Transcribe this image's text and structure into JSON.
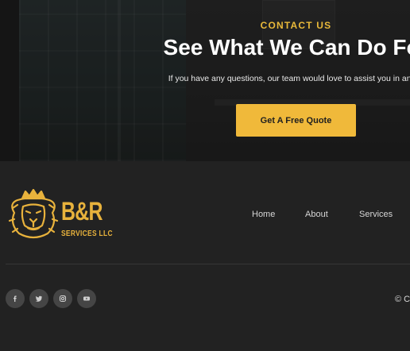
{
  "hero": {
    "eyebrow": "CONTACT US",
    "title": "See What We Can Do For",
    "subtitle": "If you have any questions, our team would love to assist you in any w",
    "cta_label": "Get A Free Quote"
  },
  "brand": {
    "name": "B&R",
    "subtitle": "SERVICES LLC"
  },
  "nav": {
    "items": [
      {
        "label": "Home"
      },
      {
        "label": "About"
      },
      {
        "label": "Services"
      }
    ]
  },
  "social": {
    "items": [
      {
        "icon": "facebook-icon"
      },
      {
        "icon": "twitter-icon"
      },
      {
        "icon": "instagram-icon"
      },
      {
        "icon": "youtube-icon"
      }
    ]
  },
  "footer": {
    "copyright": "© C"
  },
  "colors": {
    "accent": "#f0b93a",
    "background": "#222222"
  }
}
